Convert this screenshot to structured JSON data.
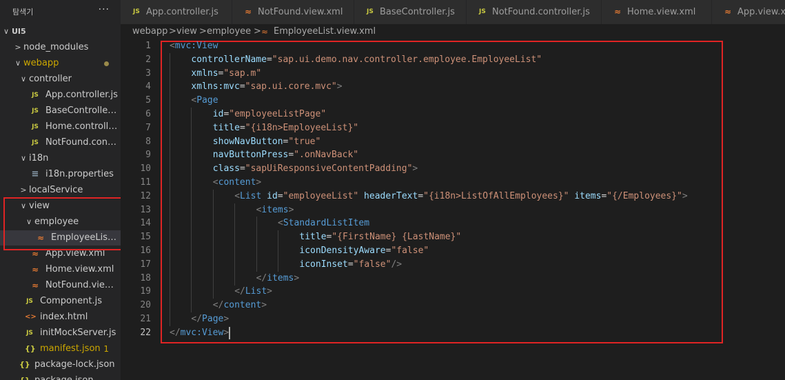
{
  "explorer": {
    "title": "탐색기",
    "menu_label": "···",
    "root": "UI5",
    "items": [
      {
        "label": "node_modules",
        "depth": 1,
        "type": "folder",
        "open": false
      },
      {
        "label": "webapp",
        "depth": 1,
        "type": "folder",
        "open": true,
        "modified": true
      },
      {
        "label": "controller",
        "depth": 2,
        "type": "folder",
        "open": true
      },
      {
        "label": "App.controller.js",
        "depth": 3,
        "type": "js"
      },
      {
        "label": "BaseController.js",
        "depth": 3,
        "type": "js"
      },
      {
        "label": "Home.controller.js",
        "depth": 3,
        "type": "js"
      },
      {
        "label": "NotFound.controll...",
        "depth": 3,
        "type": "js"
      },
      {
        "label": "i18n",
        "depth": 2,
        "type": "folder",
        "open": true
      },
      {
        "label": "i18n.properties",
        "depth": 3,
        "type": "prop"
      },
      {
        "label": "localService",
        "depth": 2,
        "type": "folder",
        "open": false
      },
      {
        "label": "view",
        "depth": 2,
        "type": "folder",
        "open": true
      },
      {
        "label": "employee",
        "depth": 3,
        "type": "folder",
        "open": true
      },
      {
        "label": "EmployeeList.vie...",
        "depth": 4,
        "type": "xml",
        "selected": true
      },
      {
        "label": "App.view.xml",
        "depth": 3,
        "type": "xml"
      },
      {
        "label": "Home.view.xml",
        "depth": 3,
        "type": "xml"
      },
      {
        "label": "NotFound.view.xml",
        "depth": 3,
        "type": "xml"
      },
      {
        "label": "Component.js",
        "depth": 2,
        "type": "js"
      },
      {
        "label": "index.html",
        "depth": 2,
        "type": "html"
      },
      {
        "label": "initMockServer.js",
        "depth": 2,
        "type": "js"
      },
      {
        "label": "manifest.json",
        "depth": 2,
        "type": "json",
        "problems": "1"
      },
      {
        "label": "package-lock.json",
        "depth": 1,
        "type": "json"
      },
      {
        "label": "package.json",
        "depth": 1,
        "type": "json"
      }
    ]
  },
  "tabs": [
    {
      "label": "App.controller.js",
      "type": "js"
    },
    {
      "label": "NotFound.view.xml",
      "type": "xml"
    },
    {
      "label": "BaseController.js",
      "type": "js"
    },
    {
      "label": "NotFound.controller.js",
      "type": "js"
    },
    {
      "label": "Home.view.xml",
      "type": "xml"
    },
    {
      "label": "App.view.xml",
      "type": "xml"
    }
  ],
  "breadcrumb": {
    "parts": [
      "webapp",
      "view",
      "employee",
      "EmployeeList.view.xml"
    ],
    "separator": ">"
  },
  "icons": {
    "js": "JS",
    "xml": "rss-icon",
    "html": "code-brackets-icon",
    "json": "curly-braces-icon",
    "prop": "list-lines-icon"
  },
  "colors": {
    "tag": "#569cd6",
    "attr": "#9cdcfe",
    "string": "#ce9178",
    "punct": "#808080",
    "highlight": "#e02424"
  },
  "code": {
    "active_line": 22,
    "lines": [
      [
        [
          "p",
          "<"
        ],
        [
          "g",
          "mvc:View"
        ]
      ],
      [
        [
          "a",
          "controllerName"
        ],
        [
          "e",
          "="
        ],
        [
          "s",
          "\"sap.ui.demo.nav.controller.employee.EmployeeList\""
        ]
      ],
      [
        [
          "a",
          "xmlns"
        ],
        [
          "e",
          "="
        ],
        [
          "s",
          "\"sap.m\""
        ]
      ],
      [
        [
          "a",
          "xmlns:mvc"
        ],
        [
          "e",
          "="
        ],
        [
          "s",
          "\"sap.ui.core.mvc\""
        ],
        [
          "p",
          ">"
        ]
      ],
      [
        [
          "p",
          "<"
        ],
        [
          "g",
          "Page"
        ]
      ],
      [
        [
          "a",
          "id"
        ],
        [
          "e",
          "="
        ],
        [
          "s",
          "\"employeeListPage\""
        ]
      ],
      [
        [
          "a",
          "title"
        ],
        [
          "e",
          "="
        ],
        [
          "s",
          "\"{i18n>EmployeeList}\""
        ]
      ],
      [
        [
          "a",
          "showNavButton"
        ],
        [
          "e",
          "="
        ],
        [
          "s",
          "\"true\""
        ]
      ],
      [
        [
          "a",
          "navButtonPress"
        ],
        [
          "e",
          "="
        ],
        [
          "s",
          "\".onNavBack\""
        ]
      ],
      [
        [
          "a",
          "class"
        ],
        [
          "e",
          "="
        ],
        [
          "s",
          "\"sapUiResponsiveContentPadding\""
        ],
        [
          "p",
          ">"
        ]
      ],
      [
        [
          "p",
          "<"
        ],
        [
          "g",
          "content"
        ],
        [
          "p",
          ">"
        ]
      ],
      [
        [
          "p",
          "<"
        ],
        [
          "g",
          "List "
        ],
        [
          "a",
          "id"
        ],
        [
          "e",
          "="
        ],
        [
          "s",
          "\"employeeList\""
        ],
        [
          "e",
          " "
        ],
        [
          "a",
          "headerText"
        ],
        [
          "e",
          "="
        ],
        [
          "s",
          "\"{i18n>ListOfAllEmployees}\""
        ],
        [
          "e",
          " "
        ],
        [
          "a",
          "items"
        ],
        [
          "e",
          "="
        ],
        [
          "s",
          "\"{/Employees}\""
        ],
        [
          "p",
          ">"
        ]
      ],
      [
        [
          "p",
          "<"
        ],
        [
          "g",
          "items"
        ],
        [
          "p",
          ">"
        ]
      ],
      [
        [
          "p",
          "<"
        ],
        [
          "g",
          "StandardListItem"
        ]
      ],
      [
        [
          "a",
          "title"
        ],
        [
          "e",
          "="
        ],
        [
          "s",
          "\"{FirstName} {LastName}\""
        ]
      ],
      [
        [
          "a",
          "iconDensityAware"
        ],
        [
          "e",
          "="
        ],
        [
          "s",
          "\"false\""
        ]
      ],
      [
        [
          "a",
          "iconInset"
        ],
        [
          "e",
          "="
        ],
        [
          "s",
          "\"false\""
        ],
        [
          "p",
          "/>"
        ]
      ],
      [
        [
          "p",
          "</"
        ],
        [
          "g",
          "items"
        ],
        [
          "p",
          ">"
        ]
      ],
      [
        [
          "p",
          "</"
        ],
        [
          "g",
          "List"
        ],
        [
          "p",
          ">"
        ]
      ],
      [
        [
          "p",
          "</"
        ],
        [
          "g",
          "content"
        ],
        [
          "p",
          ">"
        ]
      ],
      [
        [
          "p",
          "</"
        ],
        [
          "g",
          "Page"
        ],
        [
          "p",
          ">"
        ]
      ],
      [
        [
          "p",
          "</"
        ],
        [
          "g",
          "mvc:View"
        ],
        [
          "p",
          ">"
        ]
      ]
    ]
  }
}
